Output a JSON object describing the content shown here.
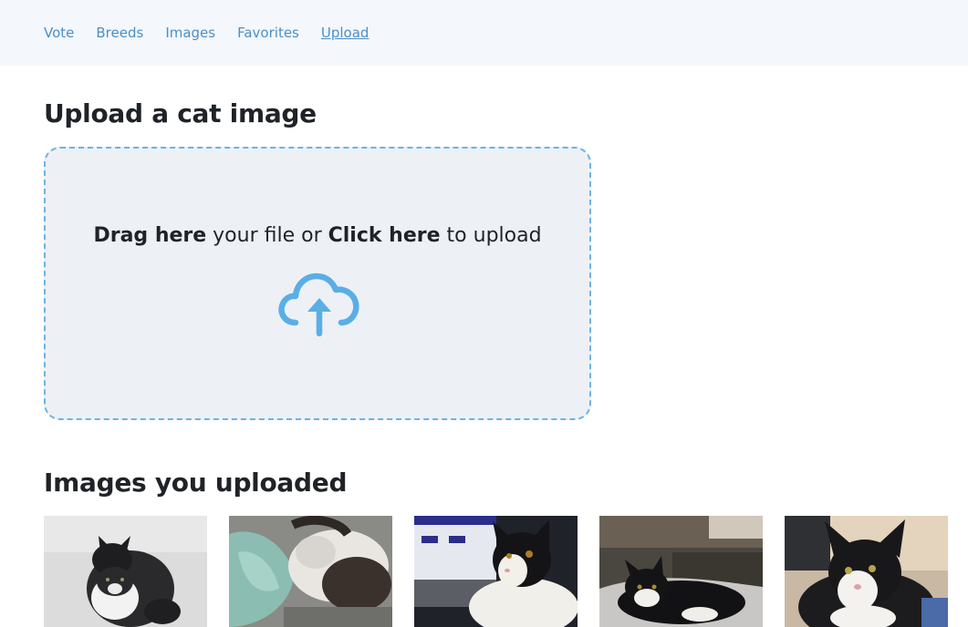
{
  "nav": {
    "items": [
      {
        "label": "Vote"
      },
      {
        "label": "Breeds"
      },
      {
        "label": "Images"
      },
      {
        "label": "Favorites"
      },
      {
        "label": "Upload"
      }
    ],
    "active": "Upload"
  },
  "upload": {
    "title": "Upload a cat image",
    "prompt_bold_1": "Drag here",
    "prompt_mid": " your file or ",
    "prompt_bold_2": "Click here",
    "prompt_end": " to upload",
    "icon": "cloud-upload-icon"
  },
  "uploaded": {
    "title": "Images you uploaded",
    "images": [
      {
        "alt": "cat-photo"
      },
      {
        "alt": "cat-photo"
      },
      {
        "alt": "cat-photo"
      },
      {
        "alt": "cat-photo"
      },
      {
        "alt": "cat-photo"
      }
    ]
  },
  "colors": {
    "accent": "#4a8fc9",
    "nav_bg": "#f4f7fb",
    "dropzone_bg": "#edf1f6",
    "dropzone_border": "#6cb3e3",
    "icon": "#5aaee6"
  }
}
